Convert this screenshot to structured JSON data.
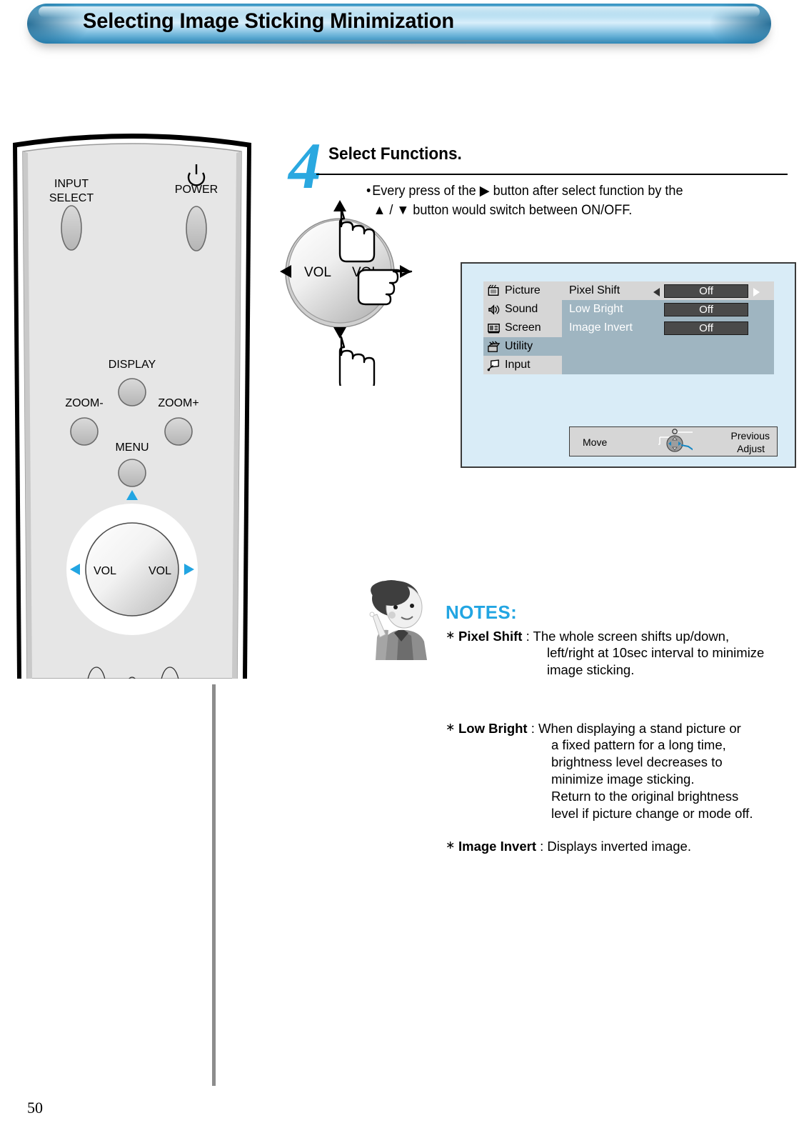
{
  "header": {
    "title": "Selecting Image Sticking Minimization"
  },
  "remote": {
    "buttons": [
      {
        "name": "input-select",
        "label": "INPUT\nSELECT"
      },
      {
        "name": "power",
        "label": "POWER"
      },
      {
        "name": "display",
        "label": "DISPLAY"
      },
      {
        "name": "zoom-minus",
        "label": "ZOOM-"
      },
      {
        "name": "zoom-plus",
        "label": "ZOOM+"
      },
      {
        "name": "menu",
        "label": "MENU"
      }
    ],
    "input_select_line1": "INPUT",
    "input_select_line2": "SELECT",
    "power_label": "POWER",
    "display_label": "DISPLAY",
    "zoom_minus_label": "ZOOM-",
    "zoom_plus_label": "ZOOM+",
    "menu_label": "MENU",
    "wheel_left_label": "VOL",
    "wheel_right_label": "VOL"
  },
  "step": {
    "number": "4",
    "title": "Select Functions.",
    "bullet": "•",
    "desc_line1": "Every press of the ▶ button after select function by the",
    "desc_line2": "▲ / ▼ button would switch between ON/OFF.",
    "wheel_left_label": "VOL",
    "wheel_right_label": "VOL"
  },
  "osd": {
    "menu_items": [
      {
        "label": "Picture",
        "icon": "picture-icon",
        "selected": false
      },
      {
        "label": "Sound",
        "icon": "sound-icon",
        "selected": false
      },
      {
        "label": "Screen",
        "icon": "screen-icon",
        "selected": false
      },
      {
        "label": "Utility",
        "icon": "utility-icon",
        "selected": true
      },
      {
        "label": "Input",
        "icon": "input-icon",
        "selected": false
      }
    ],
    "rows": [
      {
        "label": "Pixel Shift",
        "value": "Off",
        "active": true
      },
      {
        "label": "Low Bright",
        "value": "Off",
        "active": false
      },
      {
        "label": "Image Invert",
        "value": "Off",
        "active": false
      }
    ],
    "navbar": {
      "move": "Move",
      "previous": "Previous",
      "adjust": "Adjust"
    },
    "colors": {
      "panel_bg": "#d9ecf7",
      "menu_bg": "#d6d6d6",
      "content_bg": "#9fb5c1",
      "value_box": "#4a4a4a",
      "selected_row": "#d6d6d6"
    }
  },
  "notes": {
    "heading": "NOTES:",
    "star": "∗",
    "items": [
      {
        "term": "Pixel Shift",
        "separator": " : ",
        "first_line": "The whole screen shifts up/down,",
        "rest": "left/right at 10sec interval to minimize\nimage sticking."
      },
      {
        "term": "Low Bright",
        "separator": " : ",
        "first_line": "When displaying a stand picture or",
        "rest": "a fixed pattern for a long time,\nbrightness level decreases to\nminimize image sticking.\nReturn to the original brightness\nlevel if picture change or mode off."
      },
      {
        "term": "Image Invert",
        "separator": " : ",
        "first_line": "Displays inverted image.",
        "rest": ""
      }
    ]
  },
  "footer": {
    "page_number": "50"
  },
  "colors": {
    "accent_cyan": "#22a5e2",
    "banner_blue": "#2f8fbe",
    "arrow_blue": "#22a5e2"
  }
}
